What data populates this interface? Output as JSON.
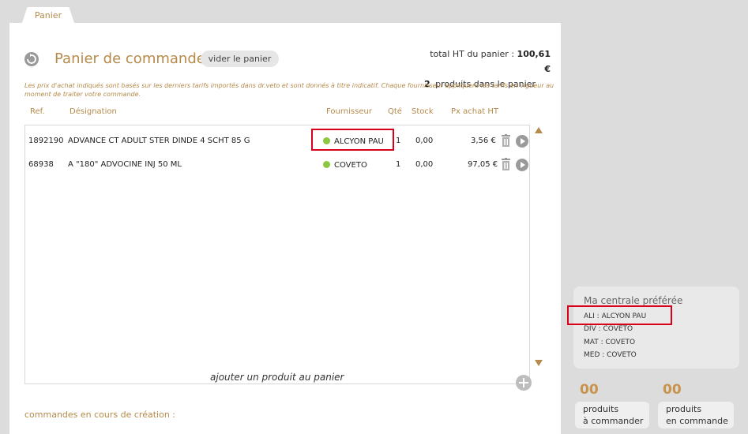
{
  "tab": {
    "label": "Panier"
  },
  "header": {
    "title": "Panier de commande",
    "empty_button": "vider le panier",
    "total_label": "total HT du panier :",
    "total_value": "100,61 €",
    "count_value": "2",
    "count_label": "produits dans le panier"
  },
  "disclaimer": "Les prix d'achat indiqués sont basés sur les derniers tarifs importés dans dr.veto et sont donnés à titre indicatif. Chaque fournisseur appliquera les tarifs en vigueur au moment de traiter votre commande.",
  "columns": {
    "ref": "Ref.",
    "designation": "Désignation",
    "supplier": "Fournisseur",
    "qty": "Qté",
    "stock": "Stock",
    "price": "Px achat HT"
  },
  "rows": [
    {
      "ref": "1892190",
      "designation": "ADVANCE CT ADULT STER DINDE  4 SCHT 85 G",
      "supplier": "ALCYON PAU",
      "qty": "1",
      "stock": "0,00",
      "price": "3,56 €",
      "status_color": "#8dc63f"
    },
    {
      "ref": "68938",
      "designation": "A \"180\" ADVOCINE INJ 50 ML",
      "supplier": "COVETO",
      "qty": "1",
      "stock": "0,00",
      "price": "97,05 €",
      "status_color": "#8dc63f"
    }
  ],
  "add_product": "ajouter un produit au panier",
  "pending_orders": "commandes en cours de création :",
  "preferred": {
    "title": "Ma centrale préférée",
    "lines": [
      "ALI : ALCYON PAU",
      "DIV : COVETO",
      "MAT : COVETO",
      "MED : COVETO"
    ]
  },
  "stats": {
    "to_order_count": "00",
    "to_order_label_1": "produits",
    "to_order_label_2": "à commander",
    "in_order_count": "00",
    "in_order_label_1": "produits",
    "in_order_label_2": "en commande"
  },
  "colors": {
    "accent": "#b58a4a",
    "highlight": "#d9001b",
    "status_ok": "#8dc63f"
  }
}
